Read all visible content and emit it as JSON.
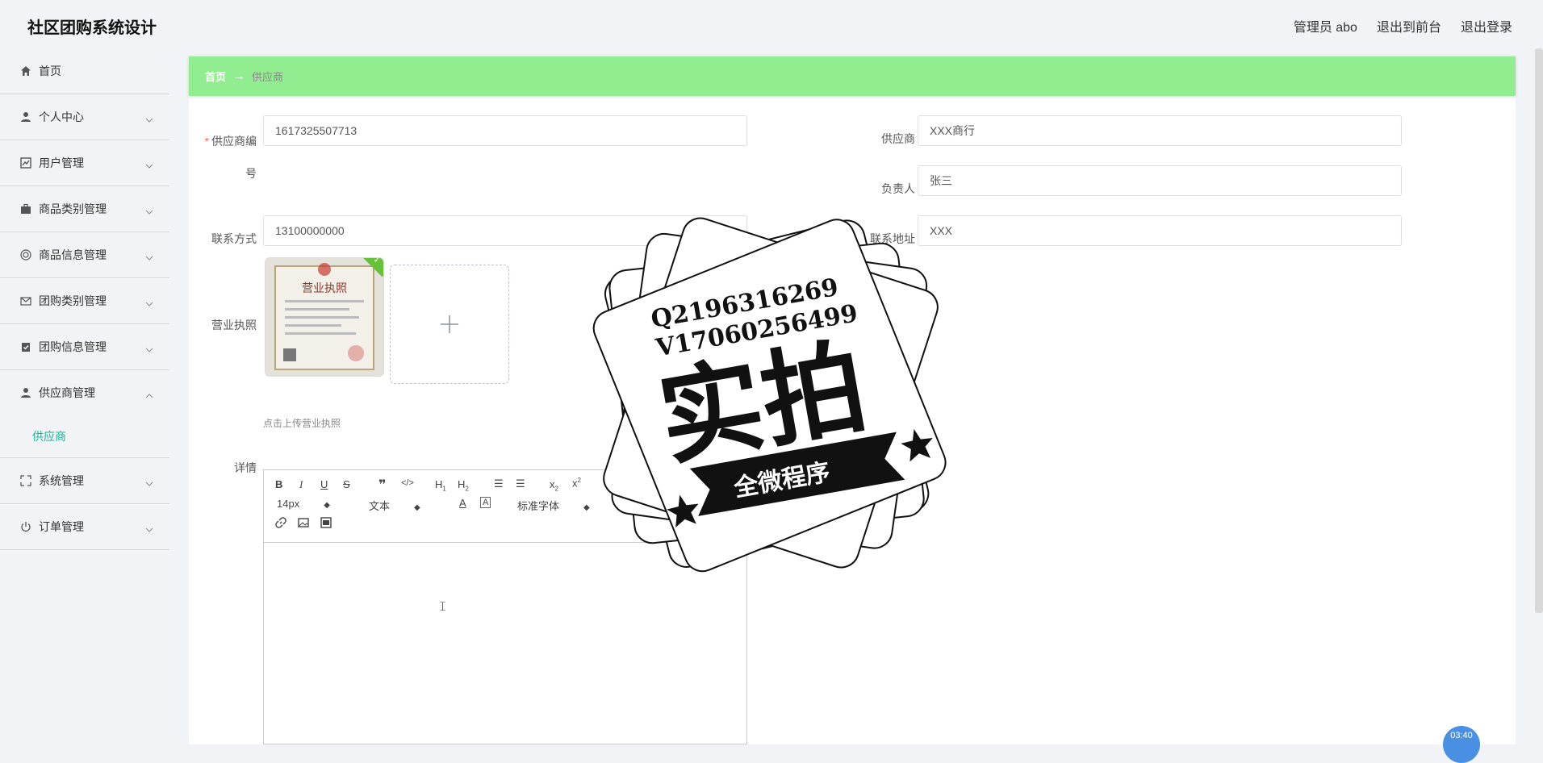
{
  "app": {
    "title": "社区团购系统设计"
  },
  "header": {
    "admin_label": "管理员 abo",
    "front_label": "退出到前台",
    "logout_label": "退出登录"
  },
  "sidebar": {
    "items": [
      {
        "label": "首页",
        "icon": "home-icon"
      },
      {
        "label": "个人中心",
        "icon": "user-icon"
      },
      {
        "label": "用户管理",
        "icon": "chart-icon"
      },
      {
        "label": "商品类别管理",
        "icon": "briefcase-icon"
      },
      {
        "label": "商品信息管理",
        "icon": "target-icon"
      },
      {
        "label": "团购类别管理",
        "icon": "mail-icon"
      },
      {
        "label": "团购信息管理",
        "icon": "clipboard-icon"
      },
      {
        "label": "供应商管理",
        "icon": "user-icon"
      },
      {
        "label": "系统管理",
        "icon": "fullscreen-icon"
      },
      {
        "label": "订单管理",
        "icon": "power-icon"
      }
    ],
    "active_sub": "供应商"
  },
  "breadcrumb": {
    "home": "首页",
    "arrow": "→",
    "current": "供应商"
  },
  "form": {
    "supplier_no_label": "供应商编号",
    "supplier_no_label_line1": "供应商编",
    "supplier_no_label_line2": "号",
    "supplier_no_value": "1617325507713",
    "supplier_name_label": "供应商",
    "supplier_name_value": "XXX商行",
    "manager_label": "负责人",
    "manager_value": "张三",
    "contact_label": "联系方式",
    "contact_value": "13100000000",
    "address_label": "联系地址",
    "address_value": "XXX",
    "license_label": "营业执照",
    "license_image_text": "营业执照",
    "upload_hint": "点击上传营业执照",
    "detail_label": "详情"
  },
  "editor": {
    "font_size": "14px",
    "text_style": "文本",
    "font_family": "标准字体"
  },
  "watermark": {
    "line1": "Q2196316269",
    "line2": "V17060256499",
    "big": "实拍",
    "banner": "全微程序"
  },
  "widget": {
    "text": "03:40"
  }
}
